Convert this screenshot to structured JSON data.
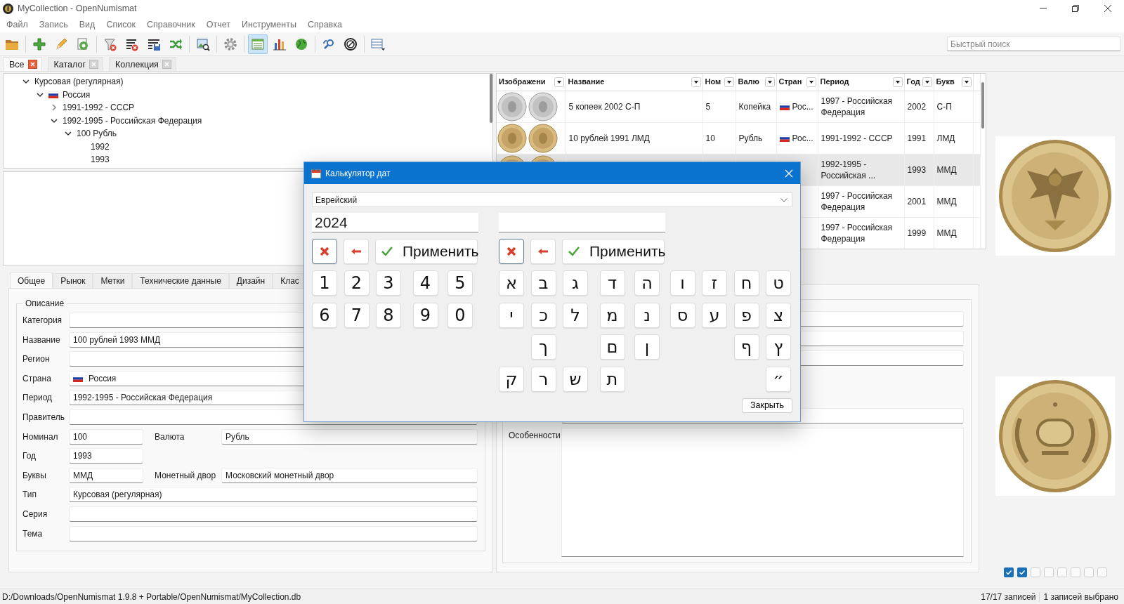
{
  "window": {
    "title": "MyCollection - OpenNumismat"
  },
  "menu": [
    "Файл",
    "Запись",
    "Вид",
    "Список",
    "Справочник",
    "Отчет",
    "Инструменты",
    "Справка"
  ],
  "toolbar": [
    [
      {
        "selected": false
      }
    ],
    [
      {
        "selected": false
      },
      {
        "selected": false
      },
      {
        "selected": false
      }
    ],
    [
      {
        "selected": false
      },
      {
        "selected": false
      },
      {
        "selected": false
      },
      {
        "selected": false
      }
    ],
    [
      {
        "selected": false
      }
    ],
    [
      {
        "selected": false
      }
    ],
    [
      {
        "selected": true
      },
      {
        "selected": false
      },
      {
        "selected": false
      }
    ],
    [
      {
        "selected": false
      },
      {
        "selected": false
      }
    ],
    [
      {
        "selected": false
      }
    ]
  ],
  "search": {
    "placeholder": "Быстрый поиск"
  },
  "collection_tabs": [
    {
      "label": "Все",
      "selected": true
    },
    {
      "label": "Каталог",
      "selected": false
    },
    {
      "label": "Коллекция",
      "selected": false
    }
  ],
  "tree": [
    {
      "label": "Курсовая (регулярная)",
      "expanded": true,
      "children": [
        {
          "label": "Россия",
          "kind": "country",
          "expanded": true,
          "children": [
            {
              "label": "1991-1992 - СССР",
              "expanded": false
            },
            {
              "label": "1992-1995 - Российская Федерация",
              "expanded": true,
              "children": [
                {
                  "label": "100 Рубль",
                  "expanded": true,
                  "children": [
                    {
                      "label": "1992"
                    },
                    {
                      "label": "1993"
                    }
                  ]
                }
              ]
            }
          ]
        }
      ]
    }
  ],
  "table": {
    "columns": [
      "Изображени",
      "Название",
      "Ном",
      "Валю",
      "Стран",
      "Период",
      "Год",
      "Букв"
    ],
    "rows": [
      {
        "selected": false,
        "name": "5 копеек 2002 С-П",
        "nominal": "5",
        "currency": "Копейка",
        "country": "Рос...",
        "period": "1997 - Российская Федерация",
        "year": "2002",
        "mint": "С-П"
      },
      {
        "selected": false,
        "name": "10 рублей 1991 ЛМД",
        "nominal": "10",
        "currency": "Рубль",
        "country": "Рос...",
        "period": "1991-1992 - СССР",
        "year": "1991",
        "mint": "ЛМД"
      },
      {
        "selected": true,
        "period": "1992-1995 - Российская ...",
        "year": "1993",
        "mint": "ММД"
      },
      {
        "selected": false,
        "period": "1997 - Российская Федерация",
        "year": "2001",
        "mint": "ММД"
      },
      {
        "selected": false,
        "period": "1997 - Российская Федерация",
        "year": "1999",
        "mint": "ММД"
      }
    ]
  },
  "details": {
    "tabs": [
      {
        "label": "Общее",
        "selected": true
      },
      {
        "label": "Рынок",
        "selected": false
      },
      {
        "label": "Метки",
        "selected": false
      },
      {
        "label": "Технические данные",
        "selected": false
      },
      {
        "label": "Дизайн",
        "selected": false
      },
      {
        "label": "Клас",
        "selected": false
      }
    ],
    "group": "Описание",
    "rows": [
      [
        {
          "label": "Категория"
        }
      ],
      [
        {
          "label": "Название",
          "value": "100 рублей 1993 ММД"
        }
      ],
      [
        {
          "label": "Регион"
        }
      ],
      [
        {
          "label": "Страна",
          "value": "Россия",
          "kind": "country"
        }
      ],
      [
        {
          "label": "Период",
          "value": "1992-1995 - Российская Федерация"
        }
      ],
      [
        {
          "label": "Правитель"
        }
      ],
      [
        {
          "label": "Номинал",
          "value": "100",
          "kind": "short"
        },
        {
          "label": "Валюта",
          "value": "Рубль"
        }
      ],
      [
        {
          "label": "Год",
          "value": "1993",
          "kind": "short"
        }
      ],
      [
        {
          "label": "Буквы",
          "value": "ММД",
          "kind": "short"
        },
        {
          "label": "Монетный двор",
          "value": "Московский монетный двор"
        }
      ],
      [
        {
          "label": "Тип",
          "value": "Курсовая (регулярная)"
        }
      ],
      [
        {
          "label": "Серия"
        }
      ],
      [
        {
          "label": "Тема"
        }
      ]
    ]
  },
  "details_right": {
    "notes_label": "Особенности"
  },
  "images": {
    "checkboxes": [
      {
        "checked": true
      },
      {
        "checked": true
      },
      {
        "checked": false
      },
      {
        "checked": false
      },
      {
        "checked": false
      },
      {
        "checked": false
      },
      {
        "checked": false
      },
      {
        "checked": false
      }
    ]
  },
  "status_bar": {
    "path": "D:/Downloads/OpenNumismat 1.9.8 + Portable/OpenNumismat/MyCollection.db",
    "records": "17/17 записей",
    "selected": "1 записей выбрано"
  },
  "date_dialog": {
    "title": "Калькулятор дат",
    "calendar": "Еврейский",
    "left": {
      "value": "2024",
      "apply": "Применить"
    },
    "right": {
      "apply": "Применить"
    },
    "digits": [
      [
        "1",
        "2",
        "3",
        "4",
        "5"
      ],
      [
        "6",
        "7",
        "8",
        "9",
        "0"
      ]
    ],
    "letters": [
      [
        {
          "kind": "key",
          "label": "ט"
        },
        {
          "kind": "key",
          "label": "ח"
        },
        {
          "kind": "key",
          "label": "ז"
        },
        {
          "kind": "key",
          "label": "ו"
        },
        {
          "kind": "key",
          "label": "ה"
        },
        {
          "kind": "key",
          "label": "ד"
        },
        {
          "kind": "key",
          "label": "ג"
        },
        {
          "kind": "key",
          "label": "ב"
        },
        {
          "kind": "key",
          "label": "א"
        }
      ],
      [
        {
          "kind": "key",
          "label": "צ"
        },
        {
          "kind": "key",
          "label": "פ"
        },
        {
          "kind": "key",
          "label": "ע"
        },
        {
          "kind": "key",
          "label": "ס"
        },
        {
          "kind": "key",
          "label": "נ"
        },
        {
          "kind": "key",
          "label": "מ"
        },
        {
          "kind": "key",
          "label": "ל"
        },
        {
          "kind": "key",
          "label": "כ"
        },
        {
          "kind": "key",
          "label": "י"
        }
      ],
      [
        {
          "kind": "key",
          "label": "ץ"
        },
        {
          "kind": "key",
          "label": "ף"
        },
        {
          "kind": "blank"
        },
        {
          "kind": "blank"
        },
        {
          "kind": "key",
          "label": "ן"
        },
        {
          "kind": "key",
          "label": "ם"
        },
        {
          "kind": "blank"
        },
        {
          "kind": "key",
          "label": "ך"
        },
        {
          "kind": "blank"
        }
      ],
      [
        {
          "kind": "key",
          "label": "״"
        },
        {
          "kind": "blank"
        },
        {
          "kind": "blank"
        },
        {
          "kind": "blank"
        },
        {
          "kind": "blank"
        },
        {
          "kind": "key",
          "label": "ת"
        },
        {
          "kind": "key",
          "label": "ש"
        },
        {
          "kind": "key",
          "label": "ר"
        },
        {
          "kind": "key",
          "label": "ק"
        }
      ]
    ],
    "close": "Закрыть"
  }
}
